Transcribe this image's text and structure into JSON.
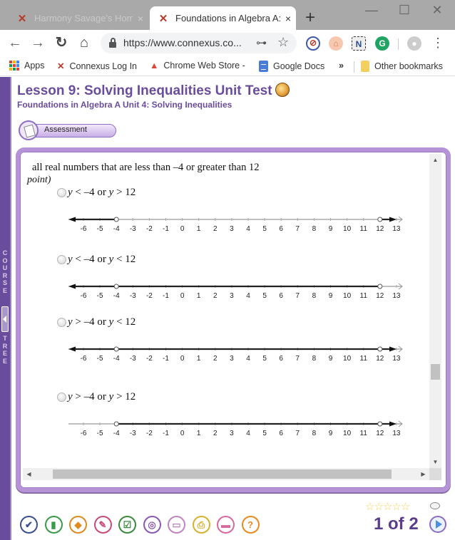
{
  "browser": {
    "tabs": [
      {
        "label": "Harmony Savage's Home",
        "active": false,
        "favicon": "connexus-icon"
      },
      {
        "label": "Foundations in Algebra A:",
        "active": true,
        "favicon": "connexus-icon"
      }
    ],
    "tab_close": "×",
    "new_tab": "+",
    "window_controls": {
      "minimize": "—",
      "maximize": "☐",
      "close": "✕"
    },
    "nav": {
      "back": "←",
      "forward": "→",
      "reload": "↻",
      "home": "⌂"
    },
    "url": "https://www.connexus.co...",
    "key_icon": "⊶",
    "star_icon": "☆",
    "menu_icon": "⋮",
    "bookmarks": [
      {
        "label": "Apps",
        "icon": "apps-grid-icon"
      },
      {
        "label": "Connexus Log In",
        "icon": "connexus-icon"
      },
      {
        "label": "Chrome Web Store -",
        "icon": "chrome-web-store-icon"
      },
      {
        "label": "Google Docs",
        "icon": "google-docs-icon"
      }
    ],
    "bookmarks_overflow": "»",
    "other_bookmarks": "Other bookmarks"
  },
  "course_tree": {
    "top_label": "COURSE",
    "bottom_label": "TREE"
  },
  "lesson": {
    "title": "Lesson 9: Solving Inequalities Unit Test",
    "subtitle": "Foundations in Algebra A  Unit 4: Solving Inequalities",
    "assessment_label": "Assessment"
  },
  "question": {
    "text": "all real numbers that are less than –4 or greater than 12",
    "point_fragment": "point)",
    "options": [
      {
        "label_parts": [
          "y",
          " < –4 or ",
          "y",
          " > 12"
        ],
        "graph": {
          "open_points": [
            -4,
            12
          ],
          "shaded": [
            [
              "-inf",
              -4
            ],
            [
              12,
              "inf"
            ]
          ]
        }
      },
      {
        "label_parts": [
          "y",
          " < –4 or ",
          "y",
          " < 12"
        ],
        "graph": {
          "open_points": [
            -4,
            12
          ],
          "shaded": [
            [
              "-inf",
              12
            ]
          ]
        }
      },
      {
        "label_parts": [
          "y",
          " > –4 or ",
          "y",
          " < 12"
        ],
        "graph": {
          "open_points": [
            -4,
            12
          ],
          "shaded": [
            [
              "-inf",
              "inf"
            ]
          ]
        }
      },
      {
        "label_parts": [
          "y",
          " > –4 or ",
          "y",
          " > 12"
        ],
        "graph": {
          "open_points": [
            -4,
            12
          ],
          "shaded": [
            [
              -4,
              "inf"
            ]
          ]
        }
      }
    ],
    "number_line": {
      "min": -6,
      "max": 13,
      "ticks": [
        "-6",
        "-5",
        "-4",
        "-3",
        "-2",
        "-1",
        "0",
        "1",
        "2",
        "3",
        "4",
        "5",
        "6",
        "7",
        "8",
        "9",
        "10",
        "11",
        "12",
        "13"
      ]
    }
  },
  "scrollbars": {
    "up": "▲",
    "down": "▼",
    "left": "◀",
    "right": "▶"
  },
  "footer": {
    "tools": [
      {
        "name": "check-tool",
        "glyph": "✔",
        "color": "#3d4f8c"
      },
      {
        "name": "notebook-tool",
        "glyph": "▮",
        "color": "#3a9a4a"
      },
      {
        "name": "backpack-tool",
        "glyph": "◆",
        "color": "#e08a20"
      },
      {
        "name": "pushpin-tool",
        "glyph": "✎",
        "color": "#c84a7a"
      },
      {
        "name": "checklist-tool",
        "glyph": "☑",
        "color": "#3a8a3a"
      },
      {
        "name": "target-tool",
        "glyph": "◎",
        "color": "#8a5ab0"
      },
      {
        "name": "message-tool",
        "glyph": "▭",
        "color": "#c084c0"
      },
      {
        "name": "print-tool",
        "glyph": "⎙",
        "color": "#d8b030"
      },
      {
        "name": "stapler-tool",
        "glyph": "▬",
        "color": "#d86aa0"
      },
      {
        "name": "help-tool",
        "glyph": "?",
        "color": "#e88a20"
      }
    ],
    "rating_stars": "☆☆☆☆☆",
    "rating_value": 0,
    "rating_max": 5,
    "page_label": "1 of 2",
    "current_page": 1,
    "total_pages": 2
  },
  "colors": {
    "brand_purple": "#6a4c9c",
    "frame_purple": "#b693d6"
  }
}
